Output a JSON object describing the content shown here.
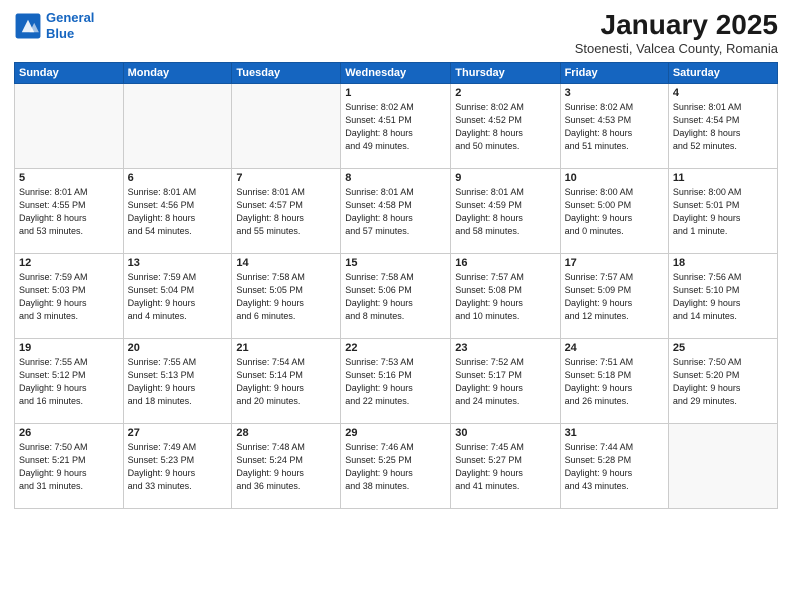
{
  "header": {
    "logo_line1": "General",
    "logo_line2": "Blue",
    "month": "January 2025",
    "location": "Stoenesti, Valcea County, Romania"
  },
  "weekdays": [
    "Sunday",
    "Monday",
    "Tuesday",
    "Wednesday",
    "Thursday",
    "Friday",
    "Saturday"
  ],
  "weeks": [
    [
      {
        "day": "",
        "info": ""
      },
      {
        "day": "",
        "info": ""
      },
      {
        "day": "",
        "info": ""
      },
      {
        "day": "1",
        "info": "Sunrise: 8:02 AM\nSunset: 4:51 PM\nDaylight: 8 hours\nand 49 minutes."
      },
      {
        "day": "2",
        "info": "Sunrise: 8:02 AM\nSunset: 4:52 PM\nDaylight: 8 hours\nand 50 minutes."
      },
      {
        "day": "3",
        "info": "Sunrise: 8:02 AM\nSunset: 4:53 PM\nDaylight: 8 hours\nand 51 minutes."
      },
      {
        "day": "4",
        "info": "Sunrise: 8:01 AM\nSunset: 4:54 PM\nDaylight: 8 hours\nand 52 minutes."
      }
    ],
    [
      {
        "day": "5",
        "info": "Sunrise: 8:01 AM\nSunset: 4:55 PM\nDaylight: 8 hours\nand 53 minutes."
      },
      {
        "day": "6",
        "info": "Sunrise: 8:01 AM\nSunset: 4:56 PM\nDaylight: 8 hours\nand 54 minutes."
      },
      {
        "day": "7",
        "info": "Sunrise: 8:01 AM\nSunset: 4:57 PM\nDaylight: 8 hours\nand 55 minutes."
      },
      {
        "day": "8",
        "info": "Sunrise: 8:01 AM\nSunset: 4:58 PM\nDaylight: 8 hours\nand 57 minutes."
      },
      {
        "day": "9",
        "info": "Sunrise: 8:01 AM\nSunset: 4:59 PM\nDaylight: 8 hours\nand 58 minutes."
      },
      {
        "day": "10",
        "info": "Sunrise: 8:00 AM\nSunset: 5:00 PM\nDaylight: 9 hours\nand 0 minutes."
      },
      {
        "day": "11",
        "info": "Sunrise: 8:00 AM\nSunset: 5:01 PM\nDaylight: 9 hours\nand 1 minute."
      }
    ],
    [
      {
        "day": "12",
        "info": "Sunrise: 7:59 AM\nSunset: 5:03 PM\nDaylight: 9 hours\nand 3 minutes."
      },
      {
        "day": "13",
        "info": "Sunrise: 7:59 AM\nSunset: 5:04 PM\nDaylight: 9 hours\nand 4 minutes."
      },
      {
        "day": "14",
        "info": "Sunrise: 7:58 AM\nSunset: 5:05 PM\nDaylight: 9 hours\nand 6 minutes."
      },
      {
        "day": "15",
        "info": "Sunrise: 7:58 AM\nSunset: 5:06 PM\nDaylight: 9 hours\nand 8 minutes."
      },
      {
        "day": "16",
        "info": "Sunrise: 7:57 AM\nSunset: 5:08 PM\nDaylight: 9 hours\nand 10 minutes."
      },
      {
        "day": "17",
        "info": "Sunrise: 7:57 AM\nSunset: 5:09 PM\nDaylight: 9 hours\nand 12 minutes."
      },
      {
        "day": "18",
        "info": "Sunrise: 7:56 AM\nSunset: 5:10 PM\nDaylight: 9 hours\nand 14 minutes."
      }
    ],
    [
      {
        "day": "19",
        "info": "Sunrise: 7:55 AM\nSunset: 5:12 PM\nDaylight: 9 hours\nand 16 minutes."
      },
      {
        "day": "20",
        "info": "Sunrise: 7:55 AM\nSunset: 5:13 PM\nDaylight: 9 hours\nand 18 minutes."
      },
      {
        "day": "21",
        "info": "Sunrise: 7:54 AM\nSunset: 5:14 PM\nDaylight: 9 hours\nand 20 minutes."
      },
      {
        "day": "22",
        "info": "Sunrise: 7:53 AM\nSunset: 5:16 PM\nDaylight: 9 hours\nand 22 minutes."
      },
      {
        "day": "23",
        "info": "Sunrise: 7:52 AM\nSunset: 5:17 PM\nDaylight: 9 hours\nand 24 minutes."
      },
      {
        "day": "24",
        "info": "Sunrise: 7:51 AM\nSunset: 5:18 PM\nDaylight: 9 hours\nand 26 minutes."
      },
      {
        "day": "25",
        "info": "Sunrise: 7:50 AM\nSunset: 5:20 PM\nDaylight: 9 hours\nand 29 minutes."
      }
    ],
    [
      {
        "day": "26",
        "info": "Sunrise: 7:50 AM\nSunset: 5:21 PM\nDaylight: 9 hours\nand 31 minutes."
      },
      {
        "day": "27",
        "info": "Sunrise: 7:49 AM\nSunset: 5:23 PM\nDaylight: 9 hours\nand 33 minutes."
      },
      {
        "day": "28",
        "info": "Sunrise: 7:48 AM\nSunset: 5:24 PM\nDaylight: 9 hours\nand 36 minutes."
      },
      {
        "day": "29",
        "info": "Sunrise: 7:46 AM\nSunset: 5:25 PM\nDaylight: 9 hours\nand 38 minutes."
      },
      {
        "day": "30",
        "info": "Sunrise: 7:45 AM\nSunset: 5:27 PM\nDaylight: 9 hours\nand 41 minutes."
      },
      {
        "day": "31",
        "info": "Sunrise: 7:44 AM\nSunset: 5:28 PM\nDaylight: 9 hours\nand 43 minutes."
      },
      {
        "day": "",
        "info": ""
      }
    ]
  ]
}
